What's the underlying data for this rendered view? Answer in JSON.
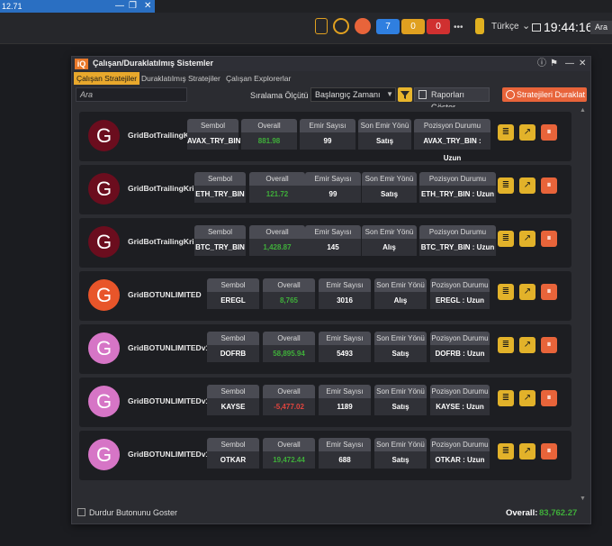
{
  "os": {
    "window_title": "12.71",
    "taskbar": {
      "counts": [
        {
          "value": "7",
          "color": "#2f7fe0"
        },
        {
          "value": "0",
          "color": "#e0a020"
        },
        {
          "value": "0",
          "color": "#d03030"
        }
      ],
      "more": "•••",
      "language": "Türkçe",
      "clock": "19:44:16",
      "search": "Ara"
    }
  },
  "window": {
    "logo": "iQ",
    "title": "Çalışan/Duraklatılmış Sistemler",
    "tabs": [
      "Çalışan Stratejiler",
      "Duraklatılmış Stratejiler",
      "Çalışan Explorerlar"
    ],
    "active_tab": 0,
    "search_placeholder": "Ara",
    "sort_label": "Sıralama Ölçütü :",
    "sort_value": "Başlangıç Zamanı",
    "reports_button": "Raporları Göster",
    "stop_button": "Stratejileri Duraklat",
    "footer_checkbox": "Durdur Butonunu Goster",
    "overall_label": "Overall:",
    "overall_value": "83,762.27"
  },
  "column_headers": [
    "Sembol",
    "Overall",
    "Emir Sayısı",
    "Son Emir Yönü",
    "Pozisyon Durumu"
  ],
  "strategies": [
    {
      "name": "GridBotTrailingK...",
      "avatar": "G",
      "avatar_color": "#6b0d1e",
      "symbol": "AVAX_TRY_BIN",
      "overall": "881.98",
      "overall_color": "green",
      "orders": "99",
      "last_dir": "Satış",
      "position": "AVAX_TRY_BIN : Uzun"
    },
    {
      "name": "GridBotTrailingKri...",
      "avatar": "G",
      "avatar_color": "#6b0d1e",
      "symbol": "ETH_TRY_BIN",
      "overall": "121.72",
      "overall_color": "green",
      "orders": "99",
      "last_dir": "Satış",
      "position": "ETH_TRY_BIN : Uzun"
    },
    {
      "name": "GridBotTrailingKri...",
      "avatar": "G",
      "avatar_color": "#6b0d1e",
      "symbol": "BTC_TRY_BIN",
      "overall": "1,428.87",
      "overall_color": "green",
      "orders": "145",
      "last_dir": "Alış",
      "position": "BTC_TRY_BIN : Uzun"
    },
    {
      "name": "GridBOTUNLIMITED",
      "avatar": "G",
      "avatar_color": "#e8552a",
      "symbol": "EREGL",
      "overall": "8,765",
      "overall_color": "green",
      "orders": "3016",
      "last_dir": "Alış",
      "position": "EREGL : Uzun"
    },
    {
      "name": "GridBOTUNLIMITEDv1...",
      "avatar": "G",
      "avatar_color": "#d675c6",
      "symbol": "DOFRB",
      "overall": "58,895.94",
      "overall_color": "green",
      "orders": "5493",
      "last_dir": "Satış",
      "position": "DOFRB : Uzun"
    },
    {
      "name": "GridBOTUNLIMITEDv1...",
      "avatar": "G",
      "avatar_color": "#d675c6",
      "symbol": "KAYSE",
      "overall": "-5,477.02",
      "overall_color": "red",
      "orders": "1189",
      "last_dir": "Satış",
      "position": "KAYSE : Uzun"
    },
    {
      "name": "GridBOTUNLIMITEDv1...",
      "avatar": "G",
      "avatar_color": "#d675c6",
      "symbol": "OTKAR",
      "overall": "19,472.44",
      "overall_color": "green",
      "orders": "688",
      "last_dir": "Satış",
      "position": "OTKAR : Uzun"
    }
  ]
}
